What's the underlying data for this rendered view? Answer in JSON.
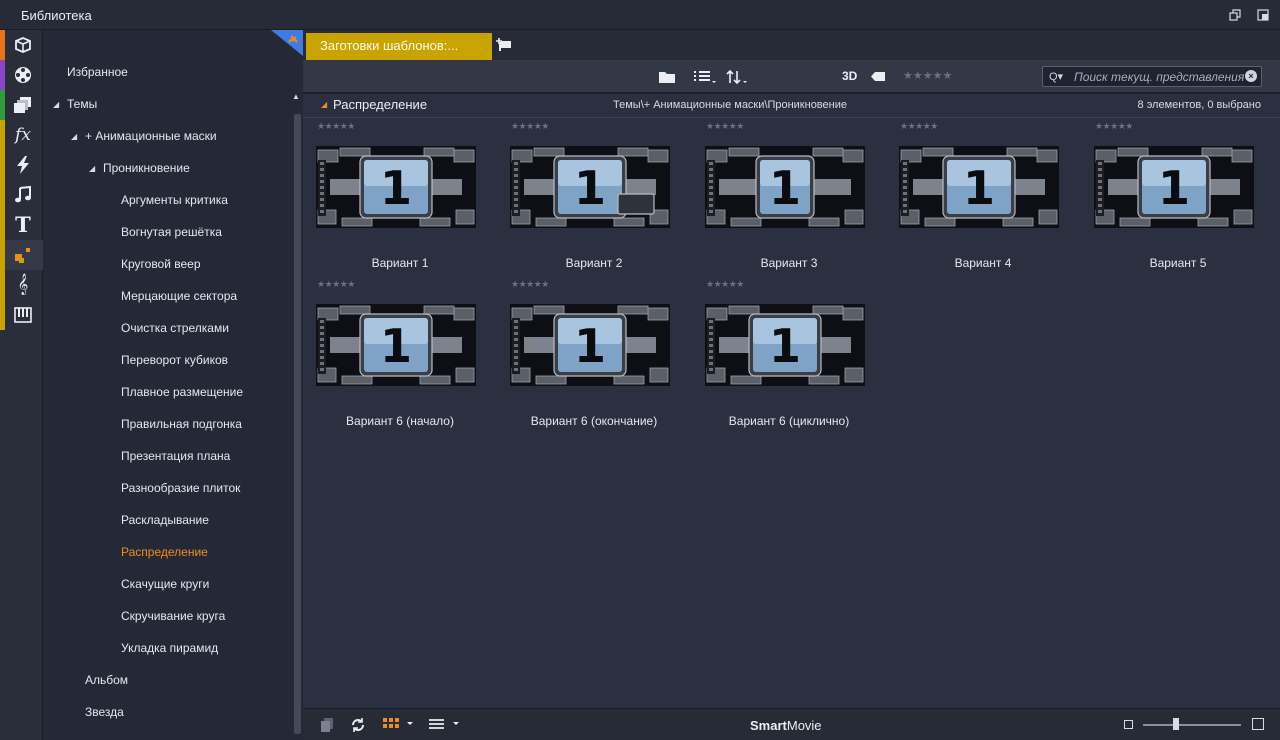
{
  "window": {
    "title": "Библиотека"
  },
  "rail": {
    "items": [
      {
        "icon": "box-icon",
        "color": "#e8731c"
      },
      {
        "icon": "film-reel-icon",
        "color": "#8e44c8"
      },
      {
        "icon": "stacked-pages-icon",
        "color": "#2f9e3a"
      },
      {
        "icon": "fx-icon",
        "color": "#c9a400"
      },
      {
        "icon": "lightning-icon",
        "color": "#c9a400"
      },
      {
        "icon": "music-note-icon",
        "color": "#c9a400"
      },
      {
        "icon": "text-title-icon",
        "color": "#c9a400"
      },
      {
        "icon": "montage-blocks-icon",
        "color": "#c9a400"
      },
      {
        "icon": "treble-clef-icon",
        "color": "#c9a400"
      },
      {
        "icon": "piano-icon",
        "color": "#c9a400"
      }
    ],
    "active_index": 7
  },
  "tree": {
    "favorites": "Избранное",
    "themes": "Темы",
    "anim_masks": "+ Анимационные маски",
    "penetration": "Проникновение",
    "items": [
      "Аргументы критика",
      "Вогнутая решётка",
      "Круговой веер",
      "Мерцающие сектора",
      "Очистка стрелками",
      "Переворот кубиков",
      "Плавное размещение",
      "Правильная подгонка",
      "Презентация плана",
      "Разнообразие плиток",
      "Раскладывание",
      "Распределение",
      "Скачущие круги",
      "Скручивание круга",
      "Укладка пирамид"
    ],
    "selected": "Распределение",
    "album": "Альбом",
    "star": "Звезда"
  },
  "tabs": {
    "active": "Заготовки шаблонов:..."
  },
  "toolbar": {
    "btn_3d": "3D",
    "stars": "★★★★★",
    "search_placeholder": "Поиск текущ. представления"
  },
  "section": {
    "name": "Распределение",
    "path": "Темы\\+ Анимационные маски\\Проникновение",
    "count": "8 элементов, 0 выбрано"
  },
  "items": [
    {
      "label": "Вариант 1",
      "stars": "★★★★★"
    },
    {
      "label": "Вариант 2",
      "stars": "★★★★★"
    },
    {
      "label": "Вариант 3",
      "stars": "★★★★★"
    },
    {
      "label": "Вариант 4",
      "stars": "★★★★★"
    },
    {
      "label": "Вариант 5",
      "stars": "★★★★★"
    },
    {
      "label": "Вариант 6 (начало)",
      "stars": "★★★★★"
    },
    {
      "label": "Вариант 6 (окончание)",
      "stars": "★★★★★"
    },
    {
      "label": "Вариант 6 (циклично)",
      "stars": "★★★★★"
    }
  ],
  "bottom": {
    "brand_bold": "Smart",
    "brand_rest": "Movie"
  },
  "colors": {
    "accent": "#f08c1e",
    "tab": "#c9a400"
  }
}
